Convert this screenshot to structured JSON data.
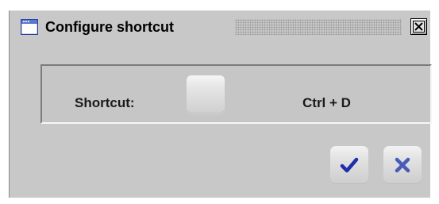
{
  "dialog": {
    "title": "Configure shortcut",
    "window_icon": "window-icon",
    "close_icon": "close-icon"
  },
  "shortcut": {
    "label": "Shortcut:",
    "value": "Ctrl + D"
  },
  "actions": {
    "ok_icon": "checkmark-icon",
    "cancel_icon": "x-icon"
  },
  "colors": {
    "dialog_background": "#c8c8c8",
    "accent_blue": "#1f2fa8",
    "text": "#1a1a1a"
  }
}
